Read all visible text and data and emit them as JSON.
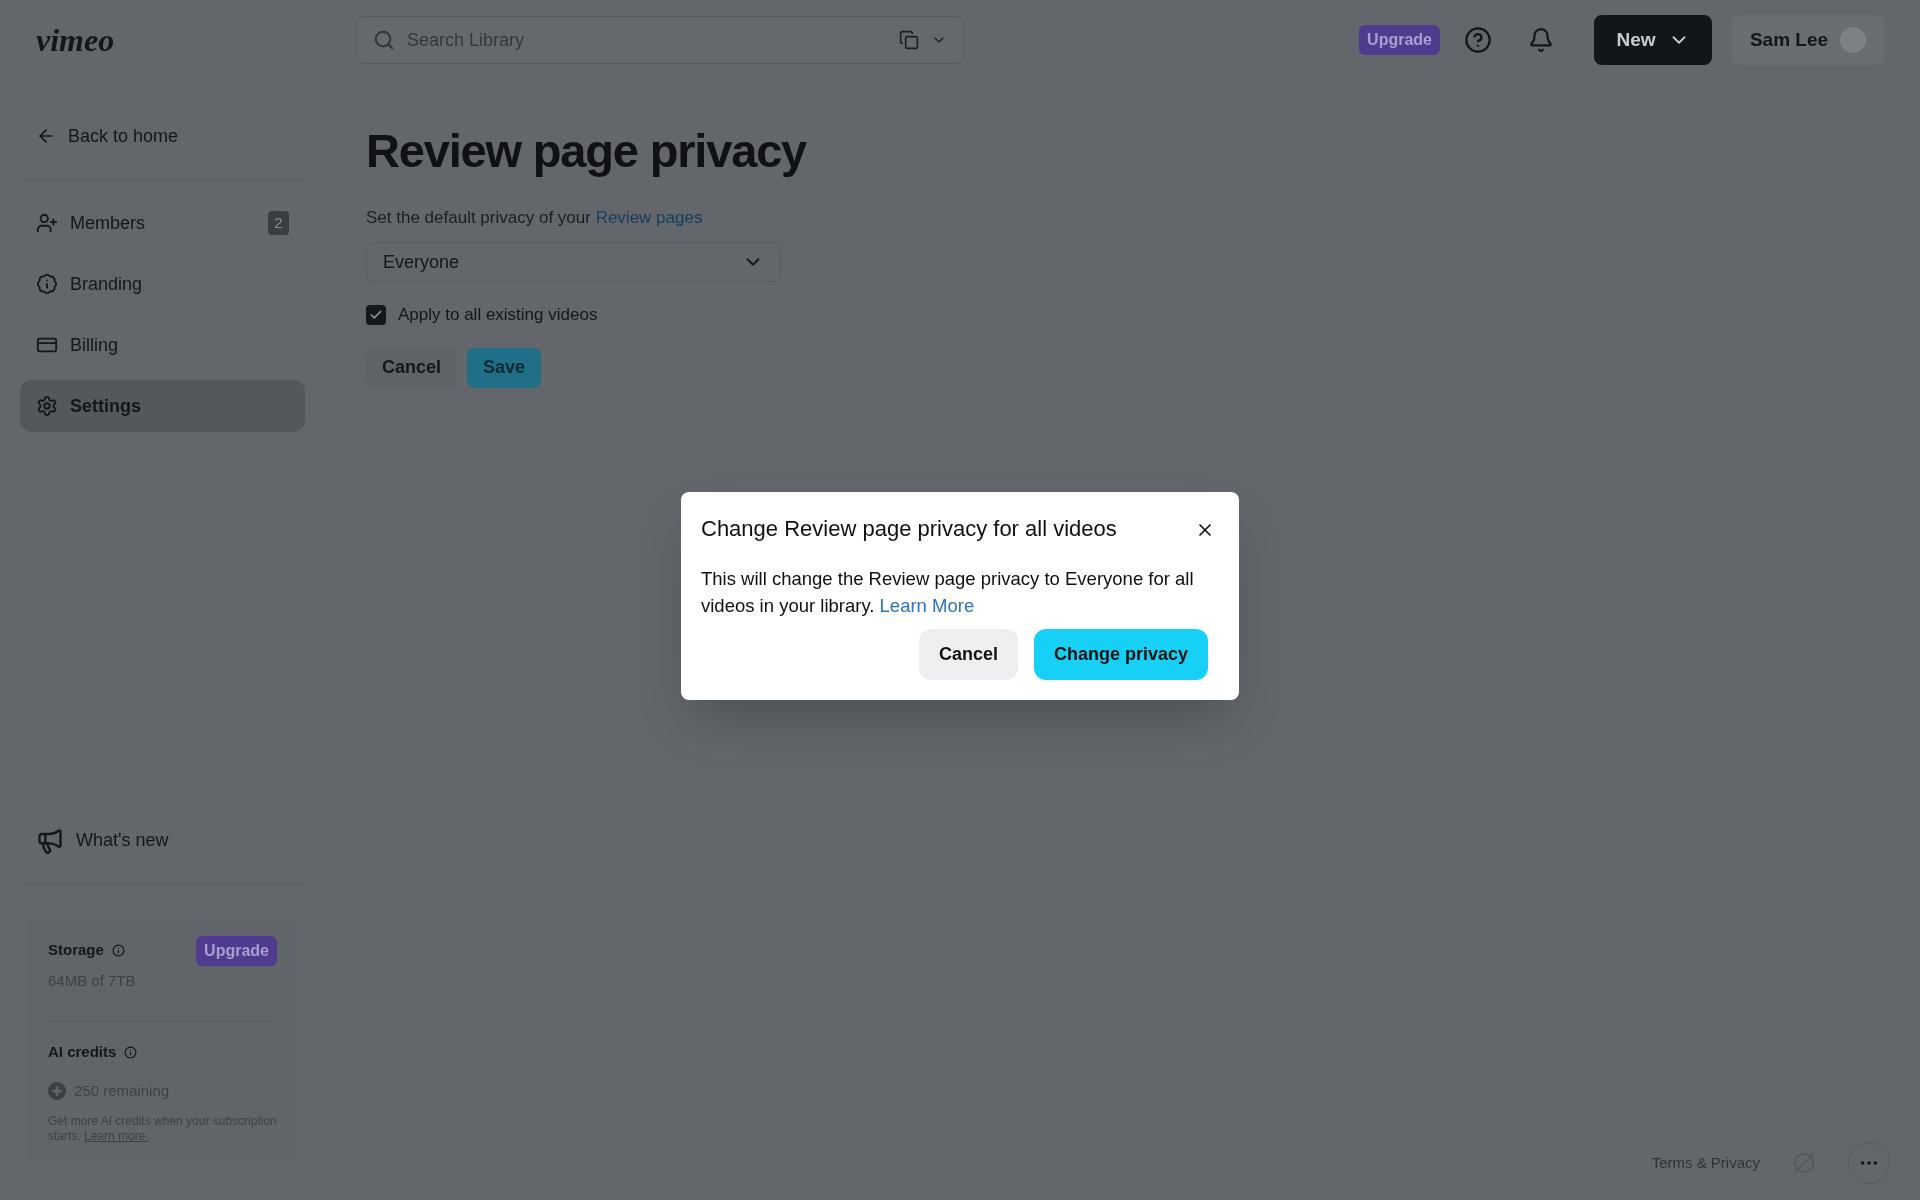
{
  "header": {
    "logo": "vimeo",
    "search": {
      "placeholder": "Search Library"
    },
    "upgrade": "Upgrade",
    "new_button": "New",
    "user": "Sam Lee"
  },
  "sidebar": {
    "back": "Back to home",
    "items": [
      {
        "kind": "members",
        "label": "Members",
        "badge": "2",
        "selected": false
      },
      {
        "kind": "branding",
        "label": "Branding",
        "selected": false
      },
      {
        "kind": "billing",
        "label": "Billing",
        "selected": false
      },
      {
        "kind": "settings",
        "label": "Settings",
        "selected": true
      }
    ],
    "whats_new": "What's new",
    "storage": {
      "title": "Storage",
      "upgrade": "Upgrade",
      "usage": "64MB of 7TB"
    },
    "ai_credits": {
      "title": "AI credits",
      "remaining": "250 remaining",
      "note": "Get more AI credits when your subscription starts.",
      "link": "Learn more."
    }
  },
  "main": {
    "title": "Review page privacy",
    "description": "Set the default privacy of your",
    "description_link": "Review pages",
    "select": {
      "value": "Everyone"
    },
    "checkbox": {
      "label": "Apply to all existing videos",
      "checked": true
    },
    "buttons": {
      "cancel": "Cancel",
      "save": "Save"
    }
  },
  "dialog": {
    "title": "Change Review page privacy for all videos",
    "body": "This will change the Review page privacy to Everyone for all videos in your library.",
    "link": "Learn More",
    "buttons": {
      "cancel": "Cancel",
      "confirm": "Change privacy"
    }
  },
  "footer": {
    "terms": "Terms & Privacy"
  }
}
